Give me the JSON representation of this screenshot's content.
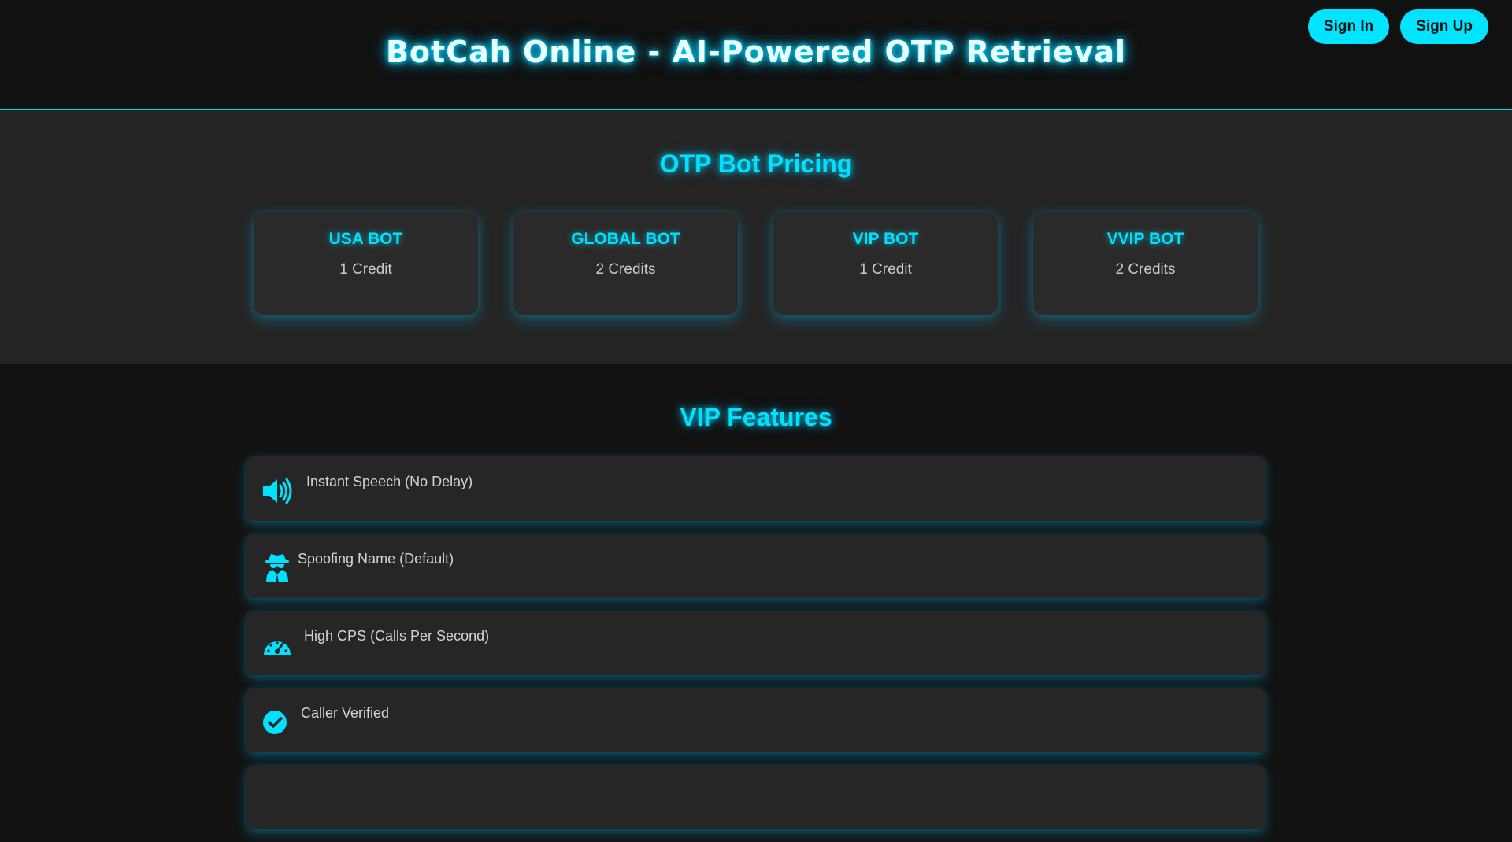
{
  "header": {
    "title": "BotCah Online - AI-Powered OTP Retrieval",
    "sign_in_label": "Sign In",
    "sign_up_label": "Sign Up"
  },
  "pricing": {
    "title": "OTP Bot Pricing",
    "plans": [
      {
        "name": "USA BOT",
        "price": "1 Credit"
      },
      {
        "name": "GLOBAL BOT",
        "price": "2 Credits"
      },
      {
        "name": "VIP BOT",
        "price": "1 Credit"
      },
      {
        "name": "VVIP BOT",
        "price": "2 Credits"
      }
    ]
  },
  "features": {
    "title": "VIP Features",
    "items": [
      {
        "label": "Instant Speech (No Delay)",
        "icon": "speaker-icon"
      },
      {
        "label": "Spoofing Name (Default)",
        "icon": "spy-icon"
      },
      {
        "label": "High CPS (Calls Per Second)",
        "icon": "speedometer-icon"
      },
      {
        "label": "Caller Verified",
        "icon": "check-circle-icon"
      },
      {
        "label": "",
        "icon": ""
      }
    ]
  },
  "colors": {
    "accent": "#00e5ff",
    "background": "#121212",
    "panel": "#242424",
    "card": "#2a2a2a"
  }
}
